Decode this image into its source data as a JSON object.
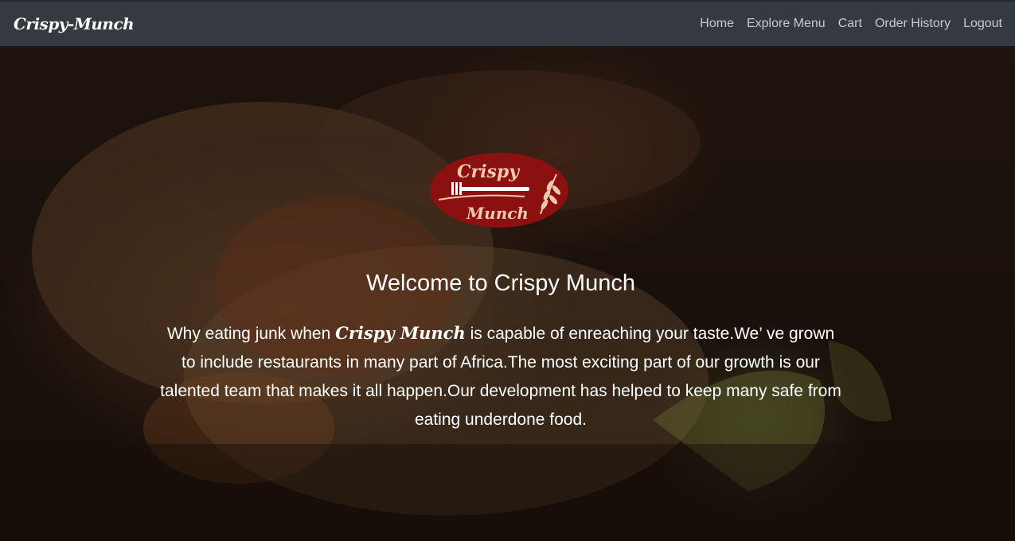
{
  "navbar": {
    "brand": "Crispy-Munch",
    "links": [
      "Home",
      "Explore Menu",
      "Cart",
      "Order History",
      "Logout"
    ]
  },
  "hero": {
    "logo_text_top": "Crispy",
    "logo_text_bottom": "Munch",
    "title": "Welcome to Crispy Munch",
    "desc_before": "Why eating junk when ",
    "desc_brand": "Crispy Munch",
    "desc_after": " is capable of enreaching your taste.We’ ve grown to include restaurants in many part of Africa.The most exciting part of our growth is our talented team that makes it all happen.Our development has helped to keep many safe from eating underdone food."
  },
  "colors": {
    "navbar_bg": "#343a40",
    "logo_bg": "#8b1111",
    "logo_accent": "#f2c9a8"
  }
}
